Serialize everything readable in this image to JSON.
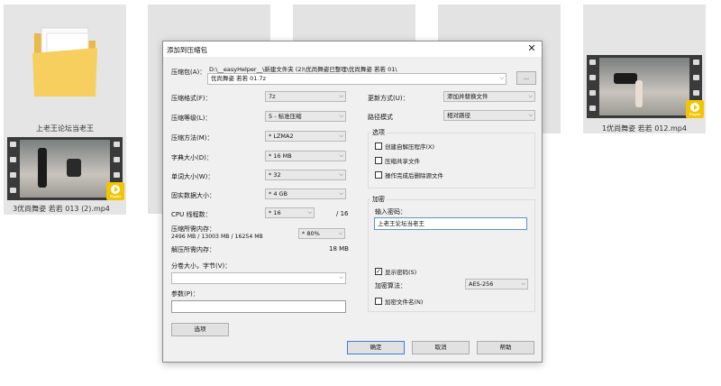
{
  "explorer": {
    "tiles": [
      {
        "label": "上老王论坛当老王"
      },
      {
        "label": "3优尚舞姿 若若 013 (2).mp4"
      },
      {
        "label": "1优尚舞姿 若若 012.mp4"
      }
    ],
    "player_badge_text": "Player"
  },
  "dialog": {
    "title": "添加到压缩包",
    "close_glyph": "✕",
    "archive_label": "压缩包(A)：",
    "archive_path_hint": "D:\\__easyHelper__\\新建文件夹 (2)\\优尚舞姿已整理\\优尚舞姿 若若 01\\",
    "archive_name": "优尚舞姿 若若 01.7z",
    "browse_label": "...",
    "format_label": "压缩格式(F)：",
    "format_value": "7z",
    "level_label": "压缩等级(L)：",
    "level_value": "5 - 标准压缩",
    "method_label": "压缩方法(M)：",
    "method_value": "* LZMA2",
    "dict_label": "字典大小(D)：",
    "dict_value": "* 16 MB",
    "word_label": "单词大小(W)：",
    "word_value": "* 32",
    "solid_label": "固实数据大小：",
    "solid_value": "* 4 GB",
    "cpu_label": "CPU 线程数：",
    "cpu_value": "* 16",
    "cpu_total": "/ 16",
    "mem_comp_label": "压缩所需内存：",
    "mem_comp_detail": "2496 MB / 13003 MB / 16254 MB",
    "mem_comp_value": "* 80%",
    "mem_decomp_label": "解压所需内存：",
    "mem_decomp_value": "18 MB",
    "split_label": "分卷大小，字节(V)：",
    "params_label": "参数(P)：",
    "options_button": "选项",
    "update_label": "更新方式(U)：",
    "update_value": "添加并替换文件",
    "path_label": "路径模式",
    "path_value": "相对路径",
    "options_group": "选项",
    "opt_sfx": "创建自解压程序(X)",
    "opt_shared": "压缩共享文件",
    "opt_delete": "操作完成后删除源文件",
    "encrypt_group": "加密",
    "password_label": "输入密码：",
    "password_value": "上老王论坛当老王",
    "show_password": "显示密码(S)",
    "enc_method_label": "加密算法：",
    "enc_method_value": "AES-256",
    "encrypt_names": "加密文件名(N)",
    "ok": "确定",
    "cancel": "取消",
    "help": "帮助"
  },
  "colors": {
    "badge": "#f5c400",
    "default_button_border": "#3c7fd0"
  }
}
